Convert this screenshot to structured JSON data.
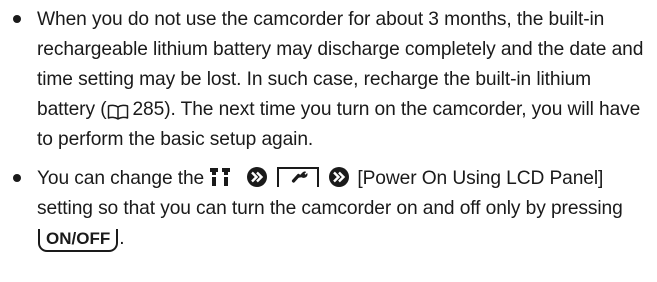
{
  "bullets": [
    {
      "text_before_ref": "When you do not use the camcorder for about 3 months, the built-in rechargeable lithium battery may discharge completely and the date and time setting may be lost. In such case, recharge the built-in lithium battery (",
      "ref_icon": "book-icon",
      "ref_page": "285",
      "text_after_ref": "). The next time you turn on the camcorder, you will have to perform the basic setup again."
    },
    {
      "text_start": "You can change the",
      "menu_icon": "camcorder-menu-icon",
      "arrow_icon": "double-arrow-right-icon",
      "tab_icon": "wrench-settings-tab-icon",
      "setting_name": "[Power On Using LCD Panel]",
      "text_middle": "setting so that you can turn the camcorder on and off only by pressing",
      "key_label": "ON/OFF",
      "text_end": "."
    }
  ],
  "colors": {
    "text": "#1a1a1a",
    "background": "#ffffff"
  }
}
